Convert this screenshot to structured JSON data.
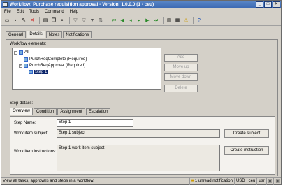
{
  "window": {
    "title": "Workflow: Purchase requisition approval - Version: 1.0.0.0 (1 - ceu)"
  },
  "menu": [
    "File",
    "Edit",
    "Tools",
    "Command",
    "Help"
  ],
  "tabs": [
    "General",
    "Details",
    "Notes",
    "Notifications"
  ],
  "workflow_elements_label": "Workflow elements:",
  "tree": {
    "root": "All",
    "items": [
      "PurchReqComplete (Required)",
      "PurchReqApproval (Required)"
    ],
    "selected": "Step 1"
  },
  "side_buttons": [
    "Add",
    "Move up",
    "Move down",
    "Delete"
  ],
  "step_details_label": "Step details:",
  "subtabs": [
    "Overview",
    "Condition",
    "Assignment",
    "Escalation"
  ],
  "form": {
    "step_name_label": "Step Name:",
    "step_name_value": "Step 1",
    "subject_label": "Work item subject:",
    "subject_value": "Step 1 subject",
    "subject_button": "Create subject",
    "instructions_label": "Work item instructions:",
    "instructions_value": "Step 1 work item subject",
    "instructions_button": "Create instruction"
  },
  "status": {
    "text": "View all tasks, approvals and steps in a workflow.",
    "notification": "1 unread notification",
    "currency": "USD",
    "company": "ceu",
    "layer": "usr"
  }
}
